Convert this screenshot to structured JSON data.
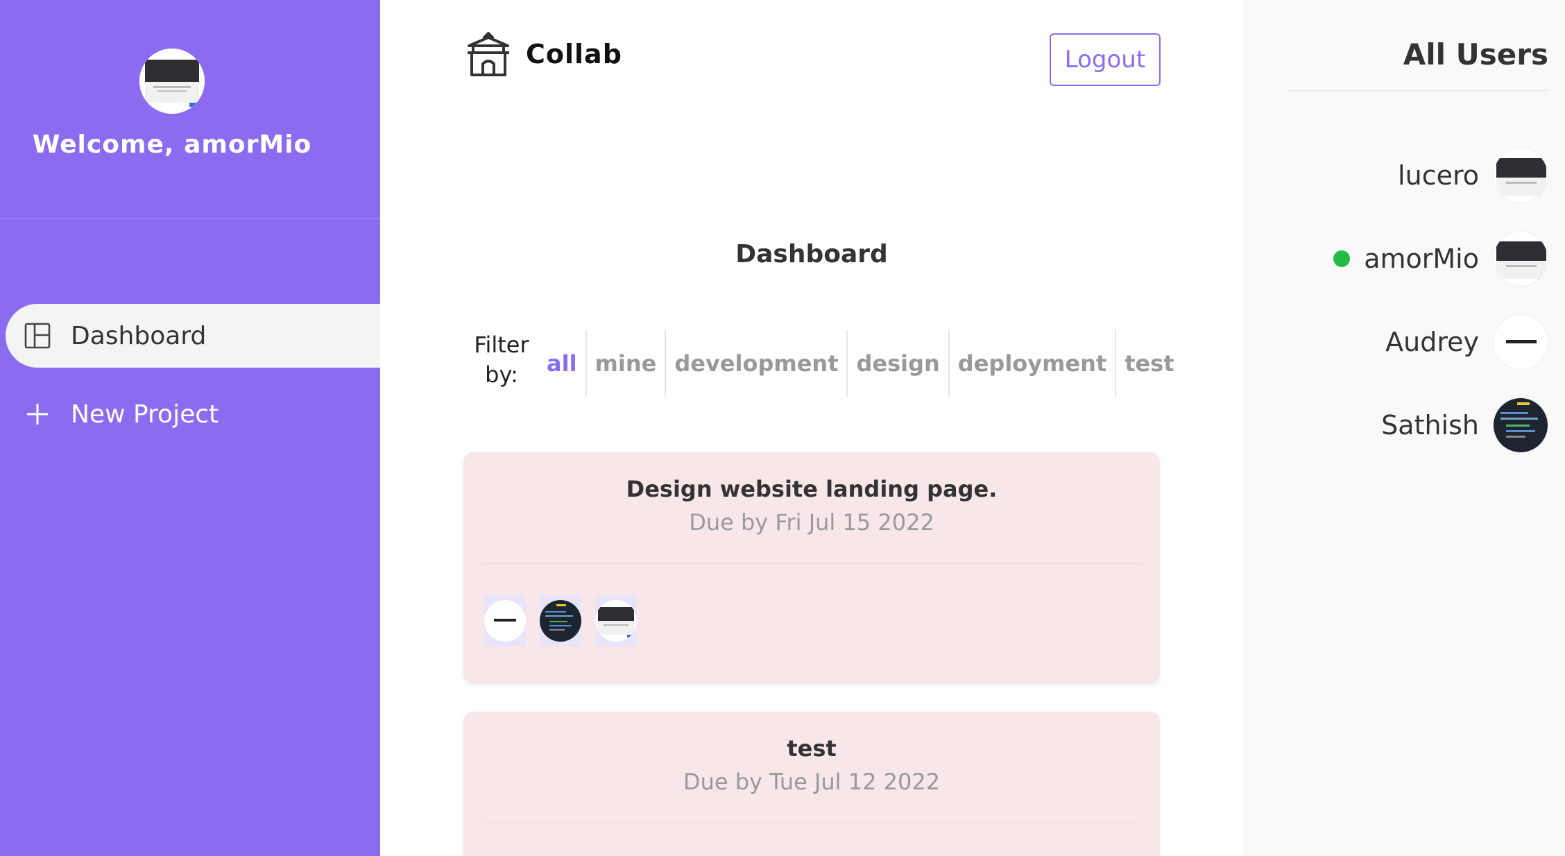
{
  "sidebar": {
    "welcome": "Welcome, amorMio",
    "nav": [
      {
        "label": "Dashboard",
        "icon": "dashboard-layout-icon",
        "active": true
      },
      {
        "label": "New Project",
        "icon": "plus-icon",
        "active": false
      }
    ]
  },
  "header": {
    "brand": "Collab",
    "brand_icon": "temple-icon",
    "logout_label": "Logout"
  },
  "main": {
    "title": "Dashboard",
    "filter": {
      "label": "Filter by:",
      "options": [
        "all",
        "mine",
        "development",
        "design",
        "deployment",
        "test"
      ],
      "selected": "all"
    },
    "projects": [
      {
        "title": "Design website landing page.",
        "due": "Due by Fri Jul 15 2022"
      },
      {
        "title": "test",
        "due": "Due by Tue Jul 12 2022"
      }
    ]
  },
  "users_panel": {
    "title": "All Users",
    "users": [
      {
        "name": "lucero",
        "online": false
      },
      {
        "name": "amorMio",
        "online": true
      },
      {
        "name": "Audrey",
        "online": false
      },
      {
        "name": "Sathish",
        "online": false
      }
    ]
  },
  "colors": {
    "accent": "#8b6cf1",
    "card_bg": "#f8e7e9",
    "online": "#22bb44"
  }
}
